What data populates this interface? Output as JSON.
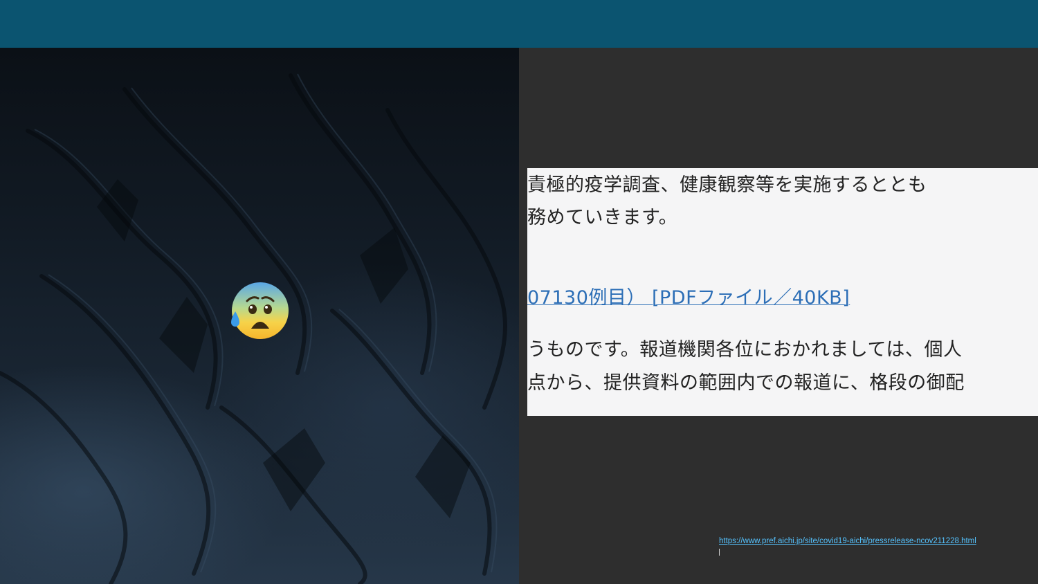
{
  "document": {
    "line1": "責極的疫学調査、健康観察等を実施するととも",
    "line2": "務めていきます。",
    "link": "07130例目） [PDFファイル／40KB]",
    "line4": "うものです。報道機関各位におかれましては、個人",
    "line5": "点から、提供資料の範囲内での報道に、格段の御配"
  },
  "source": {
    "url": "https://www.pref.aichi.jp/site/covid19-aichi/pressrelease-ncov211228.html"
  },
  "emoji": {
    "icon": "anxious-face-with-sweat-icon"
  },
  "colors": {
    "topbar": "#0b5470",
    "panel": "#2e2e2e",
    "document_bg": "#f5f5f6",
    "link": "#2c6eb6",
    "source_link": "#55c3ff"
  }
}
